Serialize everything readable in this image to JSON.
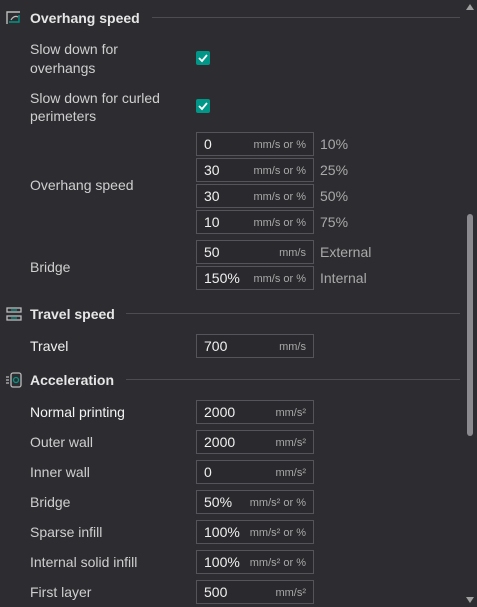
{
  "overhang": {
    "title": "Overhang speed",
    "slow_down_overhangs_line1": "Slow down for",
    "slow_down_overhangs_line2": "overhangs",
    "slow_down_curled_line1": "Slow down for curled",
    "slow_down_curled_line2": "perimeters",
    "overhang_speed_label": "Overhang speed",
    "speeds": [
      {
        "value": "0",
        "unit": "mm/s or %",
        "pct": "10%"
      },
      {
        "value": "30",
        "unit": "mm/s or %",
        "pct": "25%"
      },
      {
        "value": "30",
        "unit": "mm/s or %",
        "pct": "50%"
      },
      {
        "value": "10",
        "unit": "mm/s or %",
        "pct": "75%"
      }
    ],
    "bridge_label": "Bridge",
    "bridge": [
      {
        "value": "50",
        "unit": "mm/s",
        "side": "External"
      },
      {
        "value": "150%",
        "unit": "mm/s or %",
        "side": "Internal"
      }
    ]
  },
  "travel": {
    "title": "Travel speed",
    "label": "Travel",
    "value": "700",
    "unit": "mm/s"
  },
  "acceleration": {
    "title": "Acceleration",
    "rows": [
      {
        "label": "Normal printing",
        "value": "2000",
        "unit": "mm/s²"
      },
      {
        "label": "Outer wall",
        "value": "2000",
        "unit": "mm/s²"
      },
      {
        "label": "Inner wall",
        "value": "0",
        "unit": "mm/s²"
      },
      {
        "label": "Bridge",
        "value": "50%",
        "unit": "mm/s² or %"
      },
      {
        "label": "Sparse infill",
        "value": "100%",
        "unit": "mm/s² or %"
      },
      {
        "label": "Internal solid infill",
        "value": "100%",
        "unit": "mm/s² or %"
      },
      {
        "label": "First layer",
        "value": "500",
        "unit": "mm/s²"
      }
    ]
  },
  "colors": {
    "accent": "#009688",
    "background": "#2d2d31"
  }
}
